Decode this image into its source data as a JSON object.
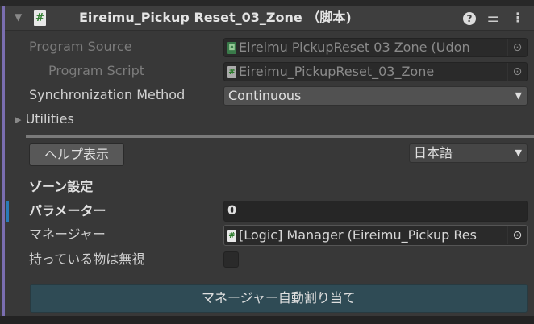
{
  "header": {
    "title": "Eireimu_Pickup Reset_03_Zone （脚本)",
    "icons": [
      "foldout-arrow-icon",
      "csharp-script-icon",
      "help-icon",
      "presets-icon",
      "more-menu-icon"
    ]
  },
  "fields": {
    "program_source": {
      "label": "Program Source",
      "value": "Eireimu PickupReset 03 Zone (Udon"
    },
    "program_script": {
      "label": "Program Script",
      "value": "Eireimu_PickupReset_03_Zone"
    },
    "sync_method": {
      "label": "Synchronization Method",
      "value": "Continuous"
    },
    "utilities": {
      "label": "Utilities"
    }
  },
  "custom": {
    "help_button": "ヘルプ表示",
    "language": "日本語",
    "section_title": "ゾーン設定",
    "parameter": {
      "label": "パラメーター",
      "value": "0"
    },
    "manager": {
      "label": "マネージャー",
      "value": "[Logic] Manager (Eireimu_Pickup Res"
    },
    "ignore_held": {
      "label": "持っている物は無視",
      "checked": false
    },
    "auto_assign_button": "マネージャー自動割り当て"
  },
  "colors": {
    "accent_bar": "#7a6eb0",
    "button": "#2f4b55",
    "modified_marker": "#2a7ab8"
  }
}
